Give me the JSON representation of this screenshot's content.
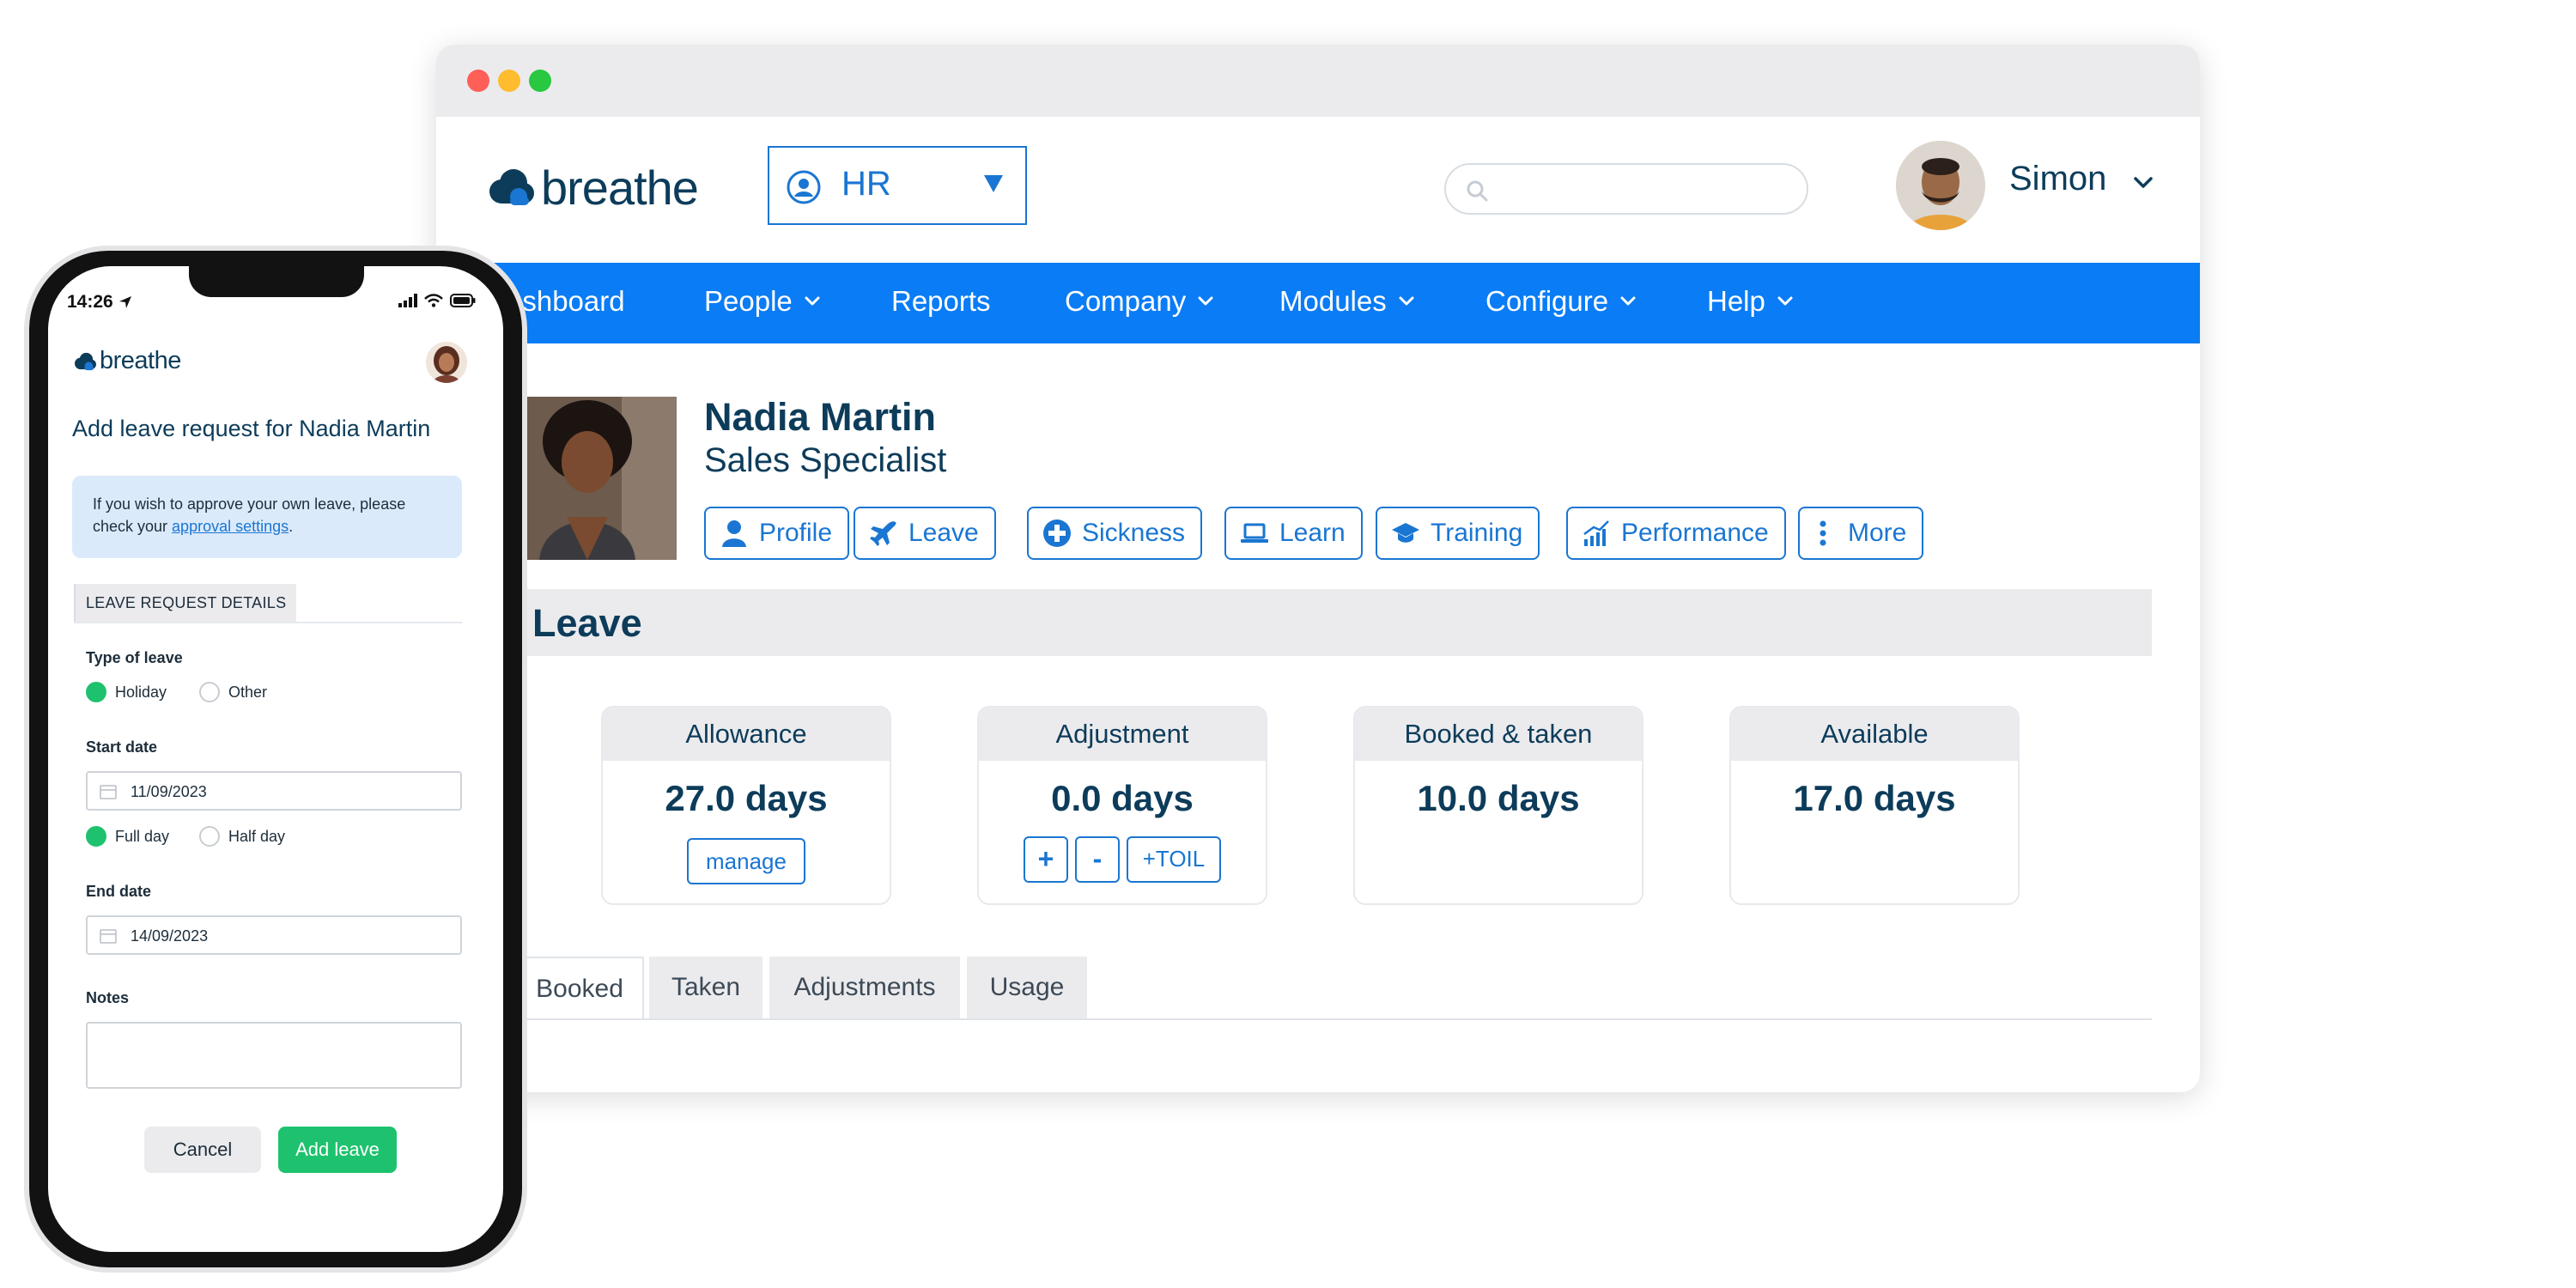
{
  "browser": {
    "logo_text": "breathe",
    "module_select": {
      "value": "HR"
    },
    "search": {
      "placeholder": ""
    },
    "user": {
      "name": "Simon"
    },
    "nav": {
      "items": [
        {
          "label": "ashboard",
          "has_menu": false
        },
        {
          "label": "People",
          "has_menu": true
        },
        {
          "label": "Reports",
          "has_menu": false
        },
        {
          "label": "Company",
          "has_menu": true
        },
        {
          "label": "Modules",
          "has_menu": true
        },
        {
          "label": "Configure",
          "has_menu": true
        },
        {
          "label": "Help",
          "has_menu": true
        }
      ]
    },
    "employee": {
      "name": "Nadia Martin",
      "title": "Sales Specialist",
      "actions": [
        "Profile",
        "Leave",
        "Sickness",
        "Learn",
        "Training",
        "Performance",
        "More"
      ]
    },
    "section_title": "Leave",
    "stats": [
      {
        "header": "Allowance",
        "value": "27.0 days",
        "button": "manage"
      },
      {
        "header": "Adjustment",
        "value": "0.0 days",
        "buttons": [
          "+",
          "-",
          "+TOIL"
        ]
      },
      {
        "header": "Booked & taken",
        "value": "10.0 days"
      },
      {
        "header": "Available",
        "value": "17.0 days"
      }
    ],
    "tabs": [
      "Booked",
      "Taken",
      "Adjustments",
      "Usage"
    ],
    "active_tab": "Booked"
  },
  "phone": {
    "time": "14:26",
    "logo_text": "breathe",
    "title": "Add leave request for Nadia Martin",
    "info": {
      "text": "If you wish to approve your own leave, please check your ",
      "link": "approval settings",
      "suffix": "."
    },
    "section": "LEAVE REQUEST DETAILS",
    "type_label": "Type of leave",
    "type_options": [
      "Holiday",
      "Other"
    ],
    "type_selected": "Holiday",
    "start_label": "Start date",
    "start_value": "11/09/2023",
    "day_options": [
      "Full day",
      "Half day"
    ],
    "day_selected": "Full day",
    "end_label": "End date",
    "end_value": "14/09/2023",
    "notes_label": "Notes",
    "cancel_label": "Cancel",
    "add_label": "Add leave"
  },
  "colors": {
    "brand_blue": "#0a7cf5",
    "link_blue": "#1a76d2",
    "navy": "#0d3c5a",
    "green": "#1ec26e"
  }
}
